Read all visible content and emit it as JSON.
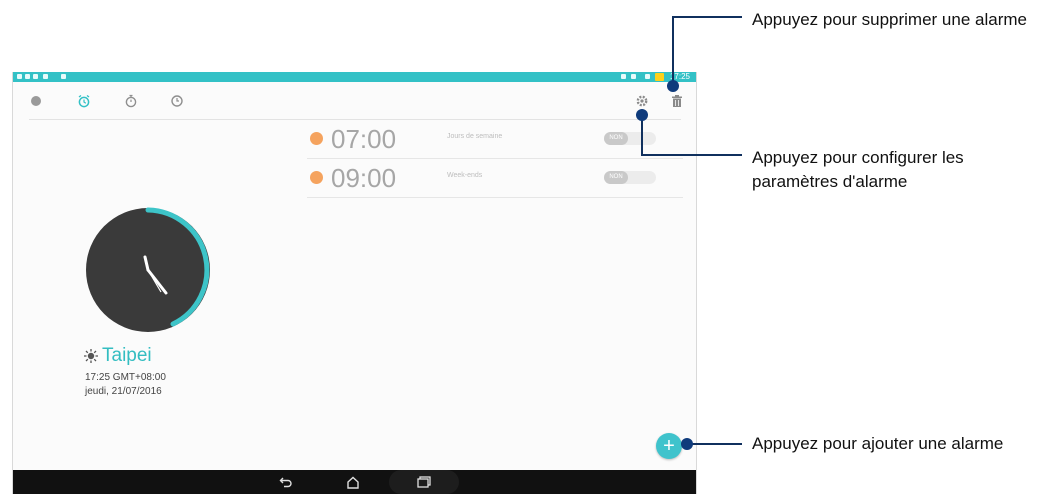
{
  "status_bar": {
    "time": "17:25"
  },
  "alarms": [
    {
      "time": "07:00",
      "repeat": "Jours de semaine",
      "toggle": "NON"
    },
    {
      "time": "09:00",
      "repeat": "Week-ends",
      "toggle": "NON"
    }
  ],
  "clock": {
    "city": "Taipei",
    "time_zone": "17:25  GMT+08:00",
    "date": "jeudi, 21/07/2016"
  },
  "callouts": {
    "delete": "Appuyez pour supprimer une alarme",
    "settings": "Appuyez pour configurer les paramètres d'alarme",
    "add": "Appuyez pour ajouter une alarme"
  },
  "colors": {
    "accent": "#33c1c6",
    "alarm_dot": "#f5a35e",
    "callout": "#0f3b7c"
  },
  "icons": {
    "tabs": [
      "world-clock-icon",
      "alarm-icon",
      "stopwatch-icon",
      "timer-icon"
    ],
    "actions": [
      "settings-icon",
      "trash-icon",
      "add-icon"
    ],
    "nav": [
      "back-icon",
      "home-icon",
      "recents-icon"
    ]
  }
}
